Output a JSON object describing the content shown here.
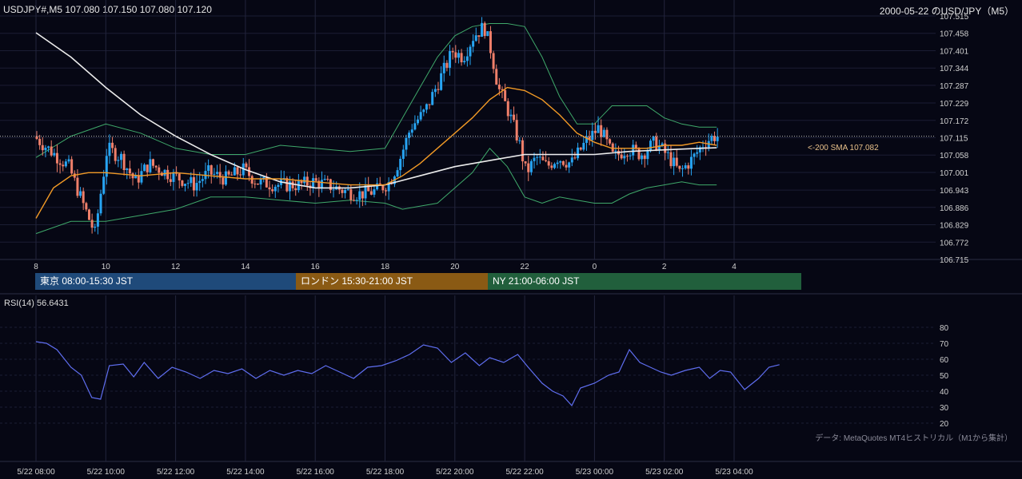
{
  "header": {
    "symbol_ohlc": "USDJPY#,M5 107.080 107.150 107.080 107.120",
    "chart_title": "2000-05-22 のUSD/JPY（M5）"
  },
  "sessions": [
    {
      "label": "東京 08:00-15:30 JST",
      "color": "#1f4a7a"
    },
    {
      "label": "ロンドン 15:30-21:00 JST",
      "color": "#8a5a14"
    },
    {
      "label": "NY 21:00-06:00 JST",
      "color": "#215f3c"
    }
  ],
  "sma_label": "<-200 SMA 107.082",
  "rsi_title": "RSI(14) 56.6431",
  "source_note": "データ: MetaQuotes MT4ヒストリカル（M1から集計）",
  "chart_data": [
    {
      "type": "candlestick",
      "x_hour_ticks": [
        "8",
        "10",
        "12",
        "14",
        "16",
        "18",
        "20",
        "22",
        "0",
        "2",
        "4"
      ],
      "y_ticks": [
        "107.515",
        "107.458",
        "107.401",
        "107.344",
        "107.287",
        "107.229",
        "107.172",
        "107.115",
        "107.058",
        "107.001",
        "106.943",
        "106.886",
        "106.829",
        "106.772",
        "106.715"
      ],
      "ylim": [
        106.715,
        107.515
      ],
      "current_price": 107.12,
      "candle_colors": {
        "up": "#27a4f2",
        "down": "#ef7f6a"
      },
      "price_path": [
        [
          0,
          107.12
        ],
        [
          0.5,
          107.07
        ],
        [
          1.0,
          107.02
        ],
        [
          1.4,
          106.9
        ],
        [
          1.75,
          106.8
        ],
        [
          2.1,
          107.08
        ],
        [
          2.5,
          107.05
        ],
        [
          2.9,
          106.97
        ],
        [
          3.3,
          107.03
        ],
        [
          3.8,
          107.0
        ],
        [
          4.2,
          106.98
        ],
        [
          4.6,
          106.96
        ],
        [
          5.0,
          107.0
        ],
        [
          5.5,
          106.98
        ],
        [
          6.0,
          107.01
        ],
        [
          6.4,
          106.97
        ],
        [
          7.0,
          106.96
        ],
        [
          7.6,
          106.96
        ],
        [
          8.0,
          106.97
        ],
        [
          8.4,
          106.96
        ],
        [
          8.9,
          106.94
        ],
        [
          9.3,
          106.93
        ],
        [
          9.8,
          106.94
        ],
        [
          10.2,
          106.97
        ],
        [
          10.5,
          107.05
        ],
        [
          10.8,
          107.15
        ],
        [
          11.2,
          107.2
        ],
        [
          11.6,
          107.3
        ],
        [
          12.0,
          107.4
        ],
        [
          12.3,
          107.38
        ],
        [
          12.6,
          107.45
        ],
        [
          12.9,
          107.48
        ],
        [
          13.1,
          107.4
        ],
        [
          13.3,
          107.28
        ],
        [
          13.6,
          107.2
        ],
        [
          13.9,
          107.1
        ],
        [
          14.1,
          107.0
        ],
        [
          14.4,
          107.05
        ],
        [
          14.7,
          107.02
        ],
        [
          15.0,
          107.05
        ],
        [
          15.4,
          107.03
        ],
        [
          15.8,
          107.1
        ],
        [
          16.2,
          107.15
        ],
        [
          16.6,
          107.05
        ],
        [
          17.0,
          107.08
        ],
        [
          17.4,
          107.06
        ],
        [
          17.8,
          107.1
        ],
        [
          18.2,
          107.05
        ],
        [
          18.5,
          107.0
        ],
        [
          18.9,
          107.05
        ],
        [
          19.2,
          107.1
        ],
        [
          19.5,
          107.12
        ]
      ],
      "moving_average_fast": [
        [
          0,
          106.85
        ],
        [
          0.5,
          106.95
        ],
        [
          1.0,
          106.99
        ],
        [
          1.5,
          107.0
        ],
        [
          2.0,
          107.0
        ],
        [
          3.0,
          106.99
        ],
        [
          4.0,
          107.0
        ],
        [
          5.0,
          106.99
        ],
        [
          6.0,
          106.98
        ],
        [
          7.0,
          106.98
        ],
        [
          8.0,
          106.97
        ],
        [
          9.0,
          106.96
        ],
        [
          10.0,
          106.96
        ],
        [
          10.5,
          106.99
        ],
        [
          11.0,
          107.03
        ],
        [
          11.5,
          107.08
        ],
        [
          12.0,
          107.13
        ],
        [
          12.5,
          107.18
        ],
        [
          13.0,
          107.24
        ],
        [
          13.5,
          107.28
        ],
        [
          14.0,
          107.27
        ],
        [
          14.5,
          107.24
        ],
        [
          15.0,
          107.19
        ],
        [
          15.5,
          107.13
        ],
        [
          16.0,
          107.1
        ],
        [
          16.5,
          107.08
        ],
        [
          17.0,
          107.08
        ],
        [
          17.5,
          107.08
        ],
        [
          18.0,
          107.09
        ],
        [
          18.5,
          107.09
        ],
        [
          19.0,
          107.1
        ],
        [
          19.5,
          107.09
        ]
      ],
      "moving_average_200": [
        [
          0,
          107.46
        ],
        [
          1.0,
          107.38
        ],
        [
          2.0,
          107.28
        ],
        [
          3.0,
          107.19
        ],
        [
          4.0,
          107.12
        ],
        [
          5.0,
          107.06
        ],
        [
          6.0,
          107.01
        ],
        [
          7.0,
          106.97
        ],
        [
          8.0,
          106.95
        ],
        [
          9.0,
          106.95
        ],
        [
          10.0,
          106.96
        ],
        [
          11.0,
          106.99
        ],
        [
          12.0,
          107.02
        ],
        [
          13.0,
          107.04
        ],
        [
          14.0,
          107.06
        ],
        [
          15.0,
          107.06
        ],
        [
          16.0,
          107.06
        ],
        [
          17.0,
          107.07
        ],
        [
          18.0,
          107.075
        ],
        [
          19.0,
          107.08
        ],
        [
          19.5,
          107.082
        ]
      ],
      "bollinger_upper": [
        [
          0,
          107.05
        ],
        [
          1.0,
          107.12
        ],
        [
          2.0,
          107.16
        ],
        [
          3.0,
          107.13
        ],
        [
          4.0,
          107.08
        ],
        [
          5.0,
          107.06
        ],
        [
          6.0,
          107.06
        ],
        [
          7.0,
          107.09
        ],
        [
          8.0,
          107.08
        ],
        [
          9.0,
          107.07
        ],
        [
          10.0,
          107.08
        ],
        [
          10.5,
          107.18
        ],
        [
          11.0,
          107.28
        ],
        [
          11.5,
          107.38
        ],
        [
          12.0,
          107.45
        ],
        [
          12.5,
          107.48
        ],
        [
          13.0,
          107.49
        ],
        [
          13.5,
          107.49
        ],
        [
          14.0,
          107.48
        ],
        [
          14.5,
          107.38
        ],
        [
          15.0,
          107.25
        ],
        [
          15.5,
          107.16
        ],
        [
          16.0,
          107.16
        ],
        [
          16.5,
          107.22
        ],
        [
          17.0,
          107.22
        ],
        [
          17.5,
          107.22
        ],
        [
          18.0,
          107.18
        ],
        [
          18.5,
          107.16
        ],
        [
          19.0,
          107.15
        ],
        [
          19.5,
          107.15
        ]
      ],
      "bollinger_lower": [
        [
          0,
          106.8
        ],
        [
          1.0,
          106.84
        ],
        [
          2.0,
          106.84
        ],
        [
          3.0,
          106.86
        ],
        [
          4.0,
          106.88
        ],
        [
          5.0,
          106.92
        ],
        [
          6.0,
          106.92
        ],
        [
          7.0,
          106.91
        ],
        [
          8.0,
          106.9
        ],
        [
          9.0,
          106.91
        ],
        [
          10.0,
          106.9
        ],
        [
          10.5,
          106.88
        ],
        [
          11.0,
          106.89
        ],
        [
          11.5,
          106.9
        ],
        [
          12.0,
          106.95
        ],
        [
          12.5,
          107.0
        ],
        [
          13.0,
          107.08
        ],
        [
          13.5,
          107.02
        ],
        [
          14.0,
          106.92
        ],
        [
          14.5,
          106.9
        ],
        [
          15.0,
          106.92
        ],
        [
          15.5,
          106.91
        ],
        [
          16.0,
          106.9
        ],
        [
          16.5,
          106.9
        ],
        [
          17.0,
          106.93
        ],
        [
          17.5,
          106.95
        ],
        [
          18.0,
          106.96
        ],
        [
          18.5,
          106.97
        ],
        [
          19.0,
          106.96
        ],
        [
          19.5,
          106.96
        ]
      ],
      "series_colors": {
        "ma_fast": "#f29a26",
        "ma_200": "#ececec",
        "bollinger": "#3fa86a"
      }
    },
    {
      "type": "line",
      "title": "RSI(14) 56.6431",
      "y_ticks": [
        "80",
        "70",
        "60",
        "50",
        "40",
        "30",
        "20"
      ],
      "ylim": [
        15,
        85
      ],
      "x_tick_labels": [
        "5/22 08:00",
        "5/22 10:00",
        "5/22 12:00",
        "5/22 14:00",
        "5/22 16:00",
        "5/22 18:00",
        "5/22 20:00",
        "5/22 22:00",
        "5/23 00:00",
        "5/23 02:00",
        "5/23 04:00"
      ],
      "color": "#5f6ef0",
      "values": [
        [
          0,
          71
        ],
        [
          0.3,
          70
        ],
        [
          0.6,
          66
        ],
        [
          1.0,
          55
        ],
        [
          1.3,
          50
        ],
        [
          1.6,
          36
        ],
        [
          1.85,
          35
        ],
        [
          2.1,
          56
        ],
        [
          2.5,
          57
        ],
        [
          2.8,
          49
        ],
        [
          3.1,
          58
        ],
        [
          3.5,
          48
        ],
        [
          3.9,
          55
        ],
        [
          4.3,
          52
        ],
        [
          4.7,
          48
        ],
        [
          5.1,
          53
        ],
        [
          5.5,
          51
        ],
        [
          5.9,
          54
        ],
        [
          6.3,
          48
        ],
        [
          6.7,
          53
        ],
        [
          7.1,
          50
        ],
        [
          7.5,
          53
        ],
        [
          7.9,
          51
        ],
        [
          8.3,
          56
        ],
        [
          8.7,
          52
        ],
        [
          9.1,
          48
        ],
        [
          9.5,
          55
        ],
        [
          9.9,
          56
        ],
        [
          10.3,
          59
        ],
        [
          10.7,
          63
        ],
        [
          11.1,
          69
        ],
        [
          11.5,
          67
        ],
        [
          11.9,
          58
        ],
        [
          12.3,
          64
        ],
        [
          12.7,
          56
        ],
        [
          13.0,
          61
        ],
        [
          13.4,
          58
        ],
        [
          13.8,
          63
        ],
        [
          14.1,
          55
        ],
        [
          14.5,
          45
        ],
        [
          14.8,
          40
        ],
        [
          15.1,
          37
        ],
        [
          15.35,
          31
        ],
        [
          15.6,
          42
        ],
        [
          16.0,
          45
        ],
        [
          16.4,
          50
        ],
        [
          16.7,
          52
        ],
        [
          17.0,
          66
        ],
        [
          17.3,
          58
        ],
        [
          17.6,
          55
        ],
        [
          17.9,
          52
        ],
        [
          18.2,
          50
        ],
        [
          18.6,
          53
        ],
        [
          19.0,
          55
        ],
        [
          19.3,
          48
        ],
        [
          19.6,
          53
        ],
        [
          19.9,
          52
        ],
        [
          20.3,
          41
        ],
        [
          20.7,
          48
        ],
        [
          21.0,
          55
        ],
        [
          21.3,
          56.6
        ]
      ]
    }
  ]
}
